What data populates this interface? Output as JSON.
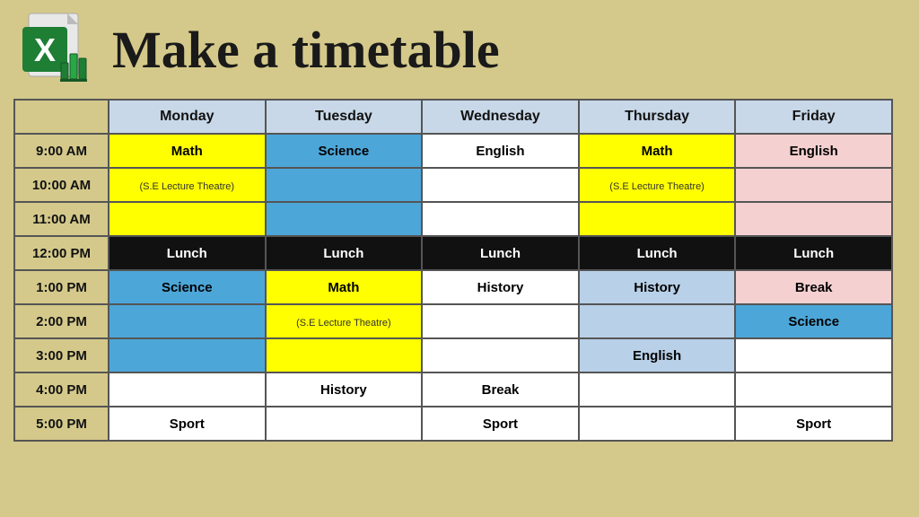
{
  "header": {
    "title": "Make a timetable"
  },
  "days": [
    "Monday",
    "Tuesday",
    "Wednesday",
    "Thursday",
    "Friday"
  ],
  "rows": [
    {
      "time": "9:00 AM",
      "cells": [
        {
          "text": "Math",
          "style": "yellow"
        },
        {
          "text": "Science",
          "style": "blue"
        },
        {
          "text": "English",
          "style": "white-cell"
        },
        {
          "text": "Math",
          "style": "yellow"
        },
        {
          "text": "English",
          "style": "pink"
        }
      ]
    },
    {
      "time": "10:00 AM",
      "cells": [
        {
          "text": "(S.E Lecture Theatre)",
          "style": "yellow",
          "sub": true
        },
        {
          "text": "",
          "style": "empty-blue"
        },
        {
          "text": "",
          "style": "empty-white"
        },
        {
          "text": "(S.E Lecture Theatre)",
          "style": "yellow",
          "sub": true
        },
        {
          "text": "",
          "style": "empty-pink"
        }
      ]
    },
    {
      "time": "11:00 AM",
      "cells": [
        {
          "text": "",
          "style": "empty-yellow"
        },
        {
          "text": "",
          "style": "empty-blue"
        },
        {
          "text": "",
          "style": "empty-white"
        },
        {
          "text": "",
          "style": "empty-yellow"
        },
        {
          "text": "",
          "style": "empty-pink"
        }
      ]
    },
    {
      "time": "12:00 PM",
      "cells": [
        {
          "text": "Lunch",
          "style": "black-row"
        },
        {
          "text": "Lunch",
          "style": "black-row"
        },
        {
          "text": "Lunch",
          "style": "black-row"
        },
        {
          "text": "Lunch",
          "style": "black-row"
        },
        {
          "text": "Lunch",
          "style": "black-row"
        }
      ]
    },
    {
      "time": "1:00 PM",
      "cells": [
        {
          "text": "Science",
          "style": "blue"
        },
        {
          "text": "Math",
          "style": "yellow"
        },
        {
          "text": "History",
          "style": "white-cell"
        },
        {
          "text": "History",
          "style": "light-blue"
        },
        {
          "text": "Break",
          "style": "pink"
        }
      ]
    },
    {
      "time": "2:00 PM",
      "cells": [
        {
          "text": "",
          "style": "empty-blue"
        },
        {
          "text": "(S.E Lecture Theatre)",
          "style": "yellow",
          "sub": true
        },
        {
          "text": "",
          "style": "empty-white"
        },
        {
          "text": "",
          "style": "empty-light-blue"
        },
        {
          "text": "Science",
          "style": "blue"
        }
      ]
    },
    {
      "time": "3:00 PM",
      "cells": [
        {
          "text": "",
          "style": "empty-blue"
        },
        {
          "text": "",
          "style": "empty-yellow"
        },
        {
          "text": "",
          "style": "empty-white"
        },
        {
          "text": "English",
          "style": "light-blue"
        },
        {
          "text": "",
          "style": "empty-white"
        }
      ]
    },
    {
      "time": "4:00 PM",
      "cells": [
        {
          "text": "",
          "style": "empty-white"
        },
        {
          "text": "History",
          "style": "white-cell"
        },
        {
          "text": "Break",
          "style": "white-cell"
        },
        {
          "text": "",
          "style": "empty-white"
        },
        {
          "text": "",
          "style": "empty-white"
        }
      ]
    },
    {
      "time": "5:00 PM",
      "cells": [
        {
          "text": "Sport",
          "style": "white-cell"
        },
        {
          "text": "",
          "style": "empty-white"
        },
        {
          "text": "Sport",
          "style": "white-cell"
        },
        {
          "text": "",
          "style": "empty-white"
        },
        {
          "text": "Sport",
          "style": "white-cell"
        }
      ]
    }
  ]
}
